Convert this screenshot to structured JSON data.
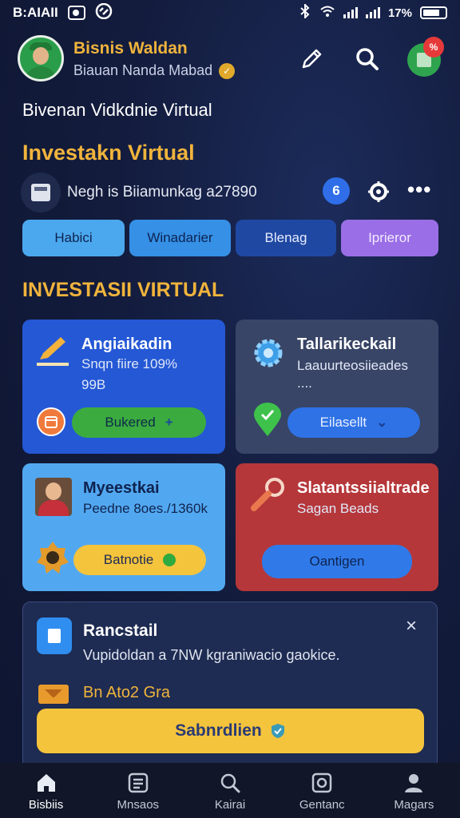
{
  "status_bar": {
    "carrier": "B:AIAII",
    "battery": "17%"
  },
  "header": {
    "brand_name": "Bisnis Waldan",
    "subtitle": "Biauan Nanda Mabad",
    "verified_glyph": "✓",
    "notification_badge": "%"
  },
  "sub_heading": "Bivenan Vidkdnie Virtual",
  "section_title": "Investakn Virtual",
  "account": {
    "text": "Negh is Biiamunkag a27890",
    "badge": "6"
  },
  "chips": [
    "Habici",
    "Winadarier",
    "Blenag",
    "Iprieror"
  ],
  "section_title_2": "INVESTASII VIRTUAL",
  "cards": [
    {
      "title": "Angiaikadin",
      "line1": "Snqn fiire 109%",
      "line2": "99B",
      "button": "Bukered",
      "button_glyph": "+"
    },
    {
      "title": "Tallarikeckail",
      "line1": "Laauurteosiieades",
      "line2": "....",
      "button": "Eilasellt",
      "button_glyph": "⌄"
    },
    {
      "title": "Myeestkai",
      "line1": "Peedne 8oes./1360k",
      "button": "Batnotie"
    },
    {
      "title": "Slatantssiialtrade",
      "line1": "Sagan Beads",
      "button": "Oantigen"
    }
  ],
  "promo": {
    "title": "Rancstail",
    "close_glyph": "×",
    "text": "Vupidoldan a 7NW kgraniwacio gaokice.",
    "label": "Bn Ato2 Gra",
    "button": "Sabnrdlien"
  },
  "bottom_nav": [
    "Bisbiis",
    "Mnsaos",
    "Kairai",
    "Gentanc",
    "Magars"
  ],
  "colors": {
    "accent_gold": "#f0b43c",
    "card_blue": "#2458d5",
    "card_slate": "#384566",
    "card_light_blue": "#52a8f0",
    "card_red": "#b5373a",
    "promo_button": "#f4c43c"
  }
}
